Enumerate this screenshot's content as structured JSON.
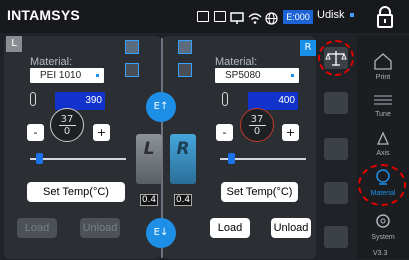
{
  "header": {
    "brand": "INTAMSYS",
    "error_code": "E:000",
    "storage": "Udisk"
  },
  "left": {
    "tag": "L",
    "material_label": "Material:",
    "material": "PEI 1010",
    "set_temp": "390",
    "current_temp": "37",
    "target_temp": "0",
    "minus": "-",
    "plus": "+",
    "settemp_button": "Set Temp(°C)",
    "load": "Load",
    "unload": "Unload",
    "nozzle_letter": "L",
    "nozzle_size": "0.4",
    "slider_level": 0.08
  },
  "right": {
    "tag": "R",
    "material_label": "Material:",
    "material": "SP5080",
    "set_temp": "400",
    "current_temp": "37",
    "target_temp": "0",
    "minus": "-",
    "plus": "+",
    "settemp_button": "Set Temp(°C)",
    "load": "Load",
    "unload": "Unload",
    "nozzle_letter": "R",
    "nozzle_size": "0.4",
    "slider_level": 0.08
  },
  "center": {
    "extruder_top": "E↑",
    "extruder_bottom": "E↓"
  },
  "nav": {
    "items": [
      {
        "label": "Print"
      },
      {
        "label": "Tune"
      },
      {
        "label": "Axis"
      },
      {
        "label": "Material"
      },
      {
        "label": "System"
      }
    ],
    "version": "V3.3"
  },
  "colors": {
    "accent": "#1d8fe6",
    "highlight": "#e00000",
    "set_temp_bg": "#1133cc"
  }
}
